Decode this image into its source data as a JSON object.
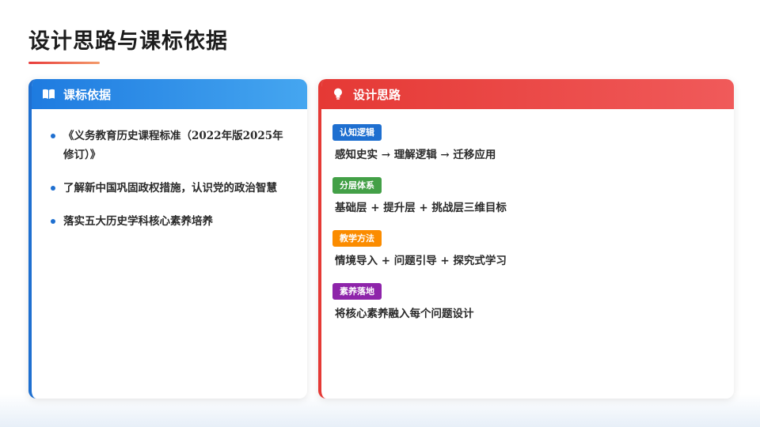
{
  "title": "设计思路与课标依据",
  "colors": {
    "accent_blue": "#1e6fd0",
    "accent_red": "#e53935"
  },
  "left_card": {
    "header_icon": "book-icon",
    "header": "课标依据",
    "items": [
      "《义务教育历史课程标准（2022年版2025年修订）》",
      "了解新中国巩固政权措施，认识党的政治智慧",
      "落实五大历史学科核心素养培养"
    ]
  },
  "right_card": {
    "header_icon": "lightbulb-icon",
    "header": "设计思路",
    "items": [
      {
        "tag": "认知逻辑",
        "tag_color": "#1e6fd0",
        "text": "感知史实 → 理解逻辑 → 迁移应用"
      },
      {
        "tag": "分层体系",
        "tag_color": "#43a047",
        "text": "基础层 + 提升层 + 挑战层三维目标"
      },
      {
        "tag": "教学方法",
        "tag_color": "#fb8c00",
        "text": "情境导入 + 问题引导 + 探究式学习"
      },
      {
        "tag": "素养落地",
        "tag_color": "#8e24aa",
        "text": "将核心素养融入每个问题设计"
      }
    ]
  }
}
